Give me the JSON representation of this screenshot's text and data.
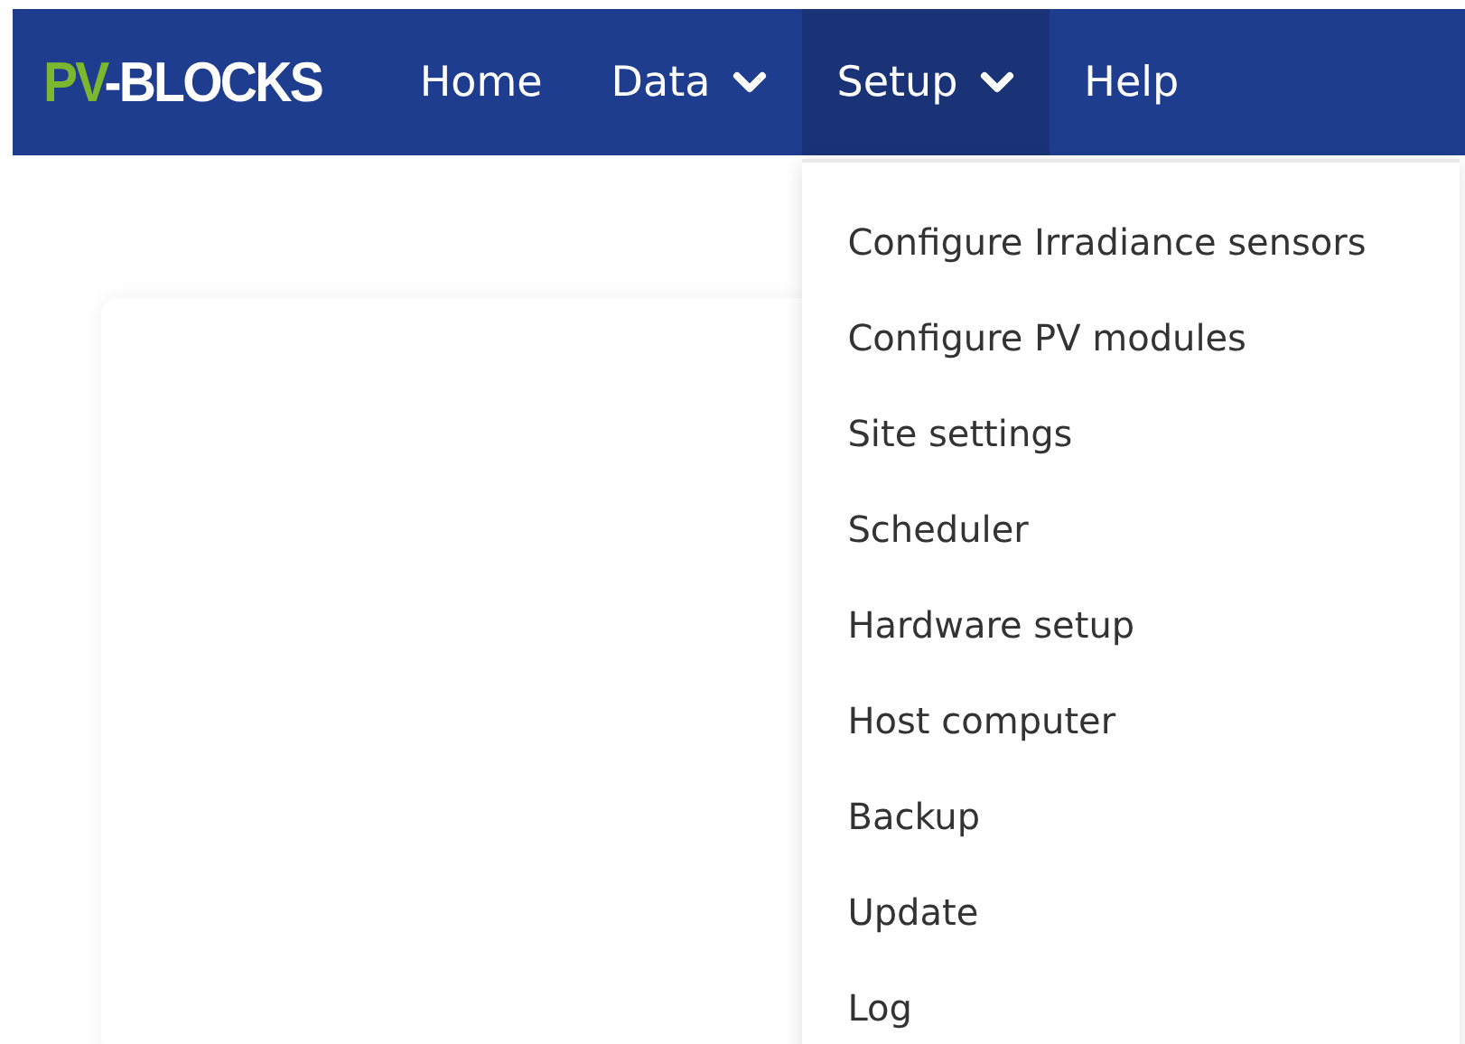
{
  "navbar": {
    "logo": {
      "accent": "PV",
      "rest": "-BLOCKS"
    },
    "items": [
      {
        "label": "Home",
        "kind": "link",
        "selected": false
      },
      {
        "label": "Data",
        "kind": "dropdown",
        "selected": false
      },
      {
        "label": "Setup",
        "kind": "dropdown",
        "selected": true
      },
      {
        "label": "Help",
        "kind": "link",
        "selected": false
      }
    ]
  },
  "dropdown_menu": {
    "items": [
      "Configure Irradiance sensors",
      "Configure PV modules",
      "Site settings",
      "Scheduler",
      "Hardware setup",
      "Host computer",
      "Backup",
      "Update",
      "Log"
    ]
  }
}
